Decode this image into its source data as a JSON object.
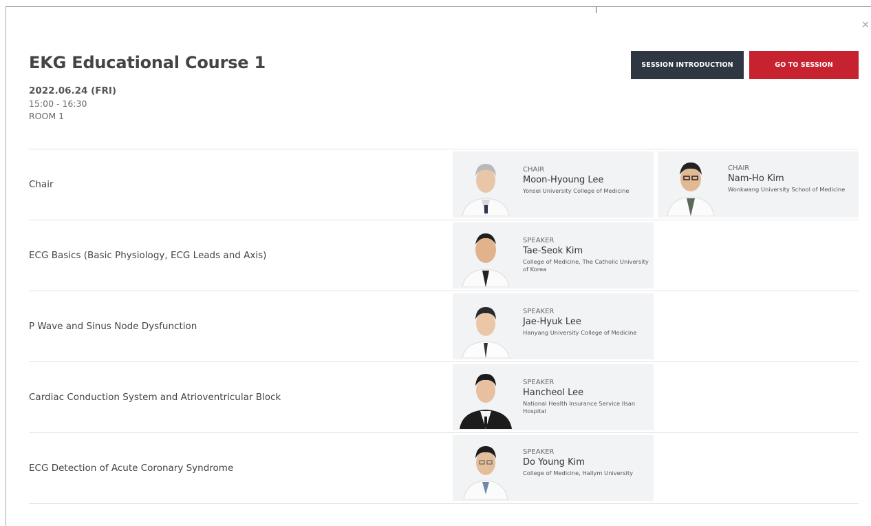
{
  "session": {
    "title": "EKG Educational Course 1",
    "date": "2022.06.24 (FRI)",
    "time": "15:00 - 16:30",
    "room": "ROOM 1"
  },
  "buttons": {
    "intro_label": "SESSION INTRODUCTION",
    "go_label": "GO TO SESSION"
  },
  "close_icon": "×",
  "colors": {
    "intro_button": "#2f3742",
    "go_button": "#c7222f",
    "card_bg": "#f2f3f5"
  },
  "rows": [
    {
      "title": "Chair",
      "people": [
        {
          "role": "CHAIR",
          "name": "Moon-Hyoung Lee",
          "affiliation": "Yonsei University College of Medicine"
        },
        {
          "role": "CHAIR",
          "name": "Nam-Ho Kim",
          "affiliation": "Wonkwang University School of Medicine"
        }
      ]
    },
    {
      "title": "ECG Basics (Basic Physiology, ECG Leads and Axis)",
      "people": [
        {
          "role": "SPEAKER",
          "name": "Tae-Seok Kim",
          "affiliation": "College of Medicine, The Catholic University of Korea"
        }
      ]
    },
    {
      "title": "P Wave and Sinus Node Dysfunction",
      "people": [
        {
          "role": "SPEAKER",
          "name": "Jae-Hyuk Lee",
          "affiliation": "Hanyang University College of Medicine"
        }
      ]
    },
    {
      "title": "Cardiac Conduction System and Atrioventricular Block",
      "people": [
        {
          "role": "SPEAKER",
          "name": "Hancheol Lee",
          "affiliation": "National Health Insurance Service Ilsan Hospital"
        }
      ]
    },
    {
      "title": "ECG Detection of Acute Coronary Syndrome",
      "people": [
        {
          "role": "SPEAKER",
          "name": "Do Young Kim",
          "affiliation": "College of Medicine, Hallym University"
        }
      ]
    }
  ]
}
